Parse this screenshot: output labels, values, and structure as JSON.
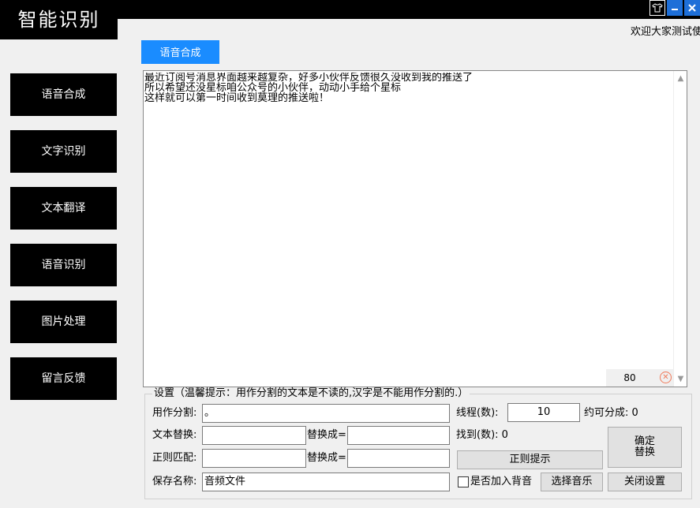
{
  "app": {
    "title": "智能识别",
    "welcome": "欢迎大家测试使用"
  },
  "window_controls": {
    "skin": "skin-icon",
    "minimize": "minimize-icon",
    "close": "close-icon"
  },
  "active_tab": {
    "label": "语音合成"
  },
  "nav": [
    {
      "label": "语音合成"
    },
    {
      "label": "文字识别"
    },
    {
      "label": "文本翻译"
    },
    {
      "label": "语音识别"
    },
    {
      "label": "图片处理"
    },
    {
      "label": "留言反馈"
    }
  ],
  "editor": {
    "text": "最近订阅号消息界面越来越复杂，好多小伙伴反馈很久没收到我的推送了\n所以希望还没星标咱公众号的小伙伴，动动小手给个星标\n这样就可以第一时间收到莫理的推送啦！",
    "char_count": "80"
  },
  "settings": {
    "legend": "设置（温馨提示：用作分割的文本是不读的,汉字是不能用作分割的.）",
    "split_label": "用作分割:",
    "split_value": "。",
    "threads_label": "线程(数):",
    "threads_value": "10",
    "segments_label": "约可分成: 0",
    "replace_label": "文本替换:",
    "replace_value": "",
    "replace_with_label": "替换成=",
    "replace_with_value": "",
    "found_label": "找到(数): 0",
    "regex_label": "正则匹配:",
    "regex_value": "",
    "regex_replace_label": "替换成=",
    "regex_replace_value": "",
    "regex_hint_button": "正则提示",
    "confirm_button_line1": "确定",
    "confirm_button_line2": "替换",
    "save_label": "保存名称:",
    "save_value": "音频文件",
    "bgm_checkbox_label": "是否加入背音",
    "choose_music_button": "选择音乐",
    "close_settings_button": "关闭设置"
  }
}
